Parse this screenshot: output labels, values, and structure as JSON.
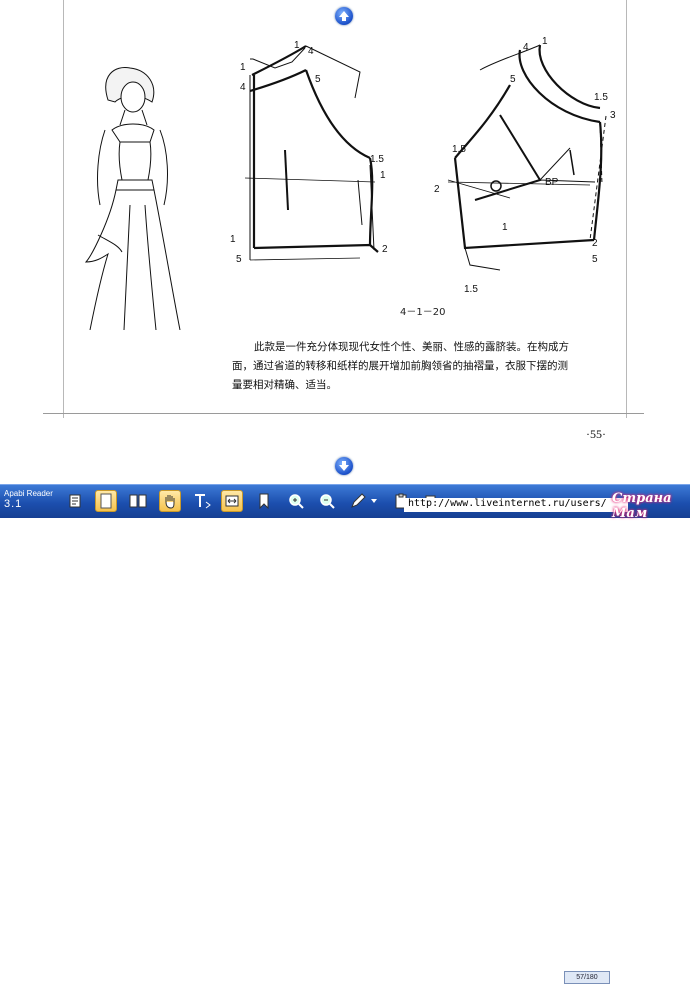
{
  "app": {
    "name": "Apabi Reader",
    "version": "3.1"
  },
  "page": {
    "figure_number": "4－1－20",
    "labels": [
      "1",
      "4",
      "5",
      "1",
      "4",
      "1.5",
      "1",
      "1",
      "2",
      "5",
      "4",
      "1",
      "5",
      "1.5",
      "3",
      "1.5",
      "2",
      "BP",
      "1",
      "2",
      "5",
      "1.5"
    ],
    "body_text": [
      "此款是一件充分体现现代女性个性、美丽、性感的露脐装。在构成方",
      "面，通过省道的转移和纸样的展开增加前胸领省的抽褶量，衣服下摆的测",
      "量要相对精确、适当。"
    ],
    "page_number": "·55·"
  },
  "toolbar": {
    "url": "http://www.liveinternet.ru/users/",
    "page_field": "57/180",
    "buttons": [
      "page-icon",
      "single-page-icon",
      "two-page-icon",
      "hand-tool-icon",
      "text-select-icon",
      "fit-width-icon",
      "bookmark-icon",
      "zoom-in-icon",
      "zoom-out-icon",
      "pen-icon",
      "dropdown-icon",
      "clipboard-icon",
      "export-icon"
    ]
  },
  "watermark": "Страна Мам"
}
